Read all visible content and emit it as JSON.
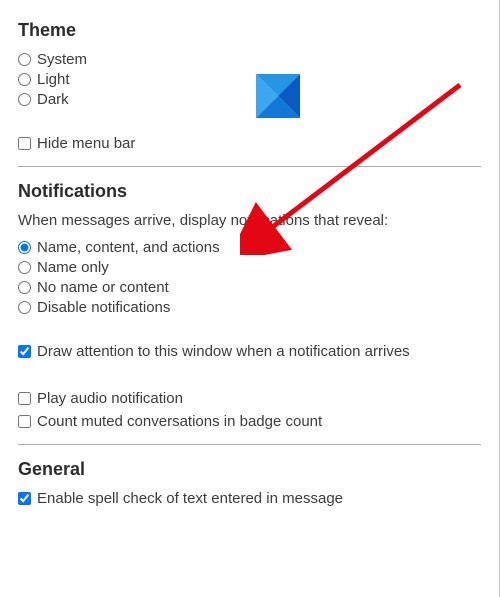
{
  "theme": {
    "title": "Theme",
    "options": [
      "System",
      "Light",
      "Dark"
    ],
    "hide_menu_bar_label": "Hide menu bar"
  },
  "notifications": {
    "title": "Notifications",
    "description": "When messages arrive, display notifications that reveal:",
    "options": [
      "Name, content, and actions",
      "Name only",
      "No name or content",
      "Disable notifications"
    ],
    "selected_index": 0,
    "draw_attention_label": "Draw attention to this window when a notification arrives",
    "draw_attention_checked": true,
    "play_audio_label": "Play audio notification",
    "play_audio_checked": false,
    "count_muted_label": "Count muted conversations in badge count",
    "count_muted_checked": false
  },
  "general": {
    "title": "General",
    "spell_check_label": "Enable spell check of text entered in message",
    "spell_check_checked": true
  }
}
